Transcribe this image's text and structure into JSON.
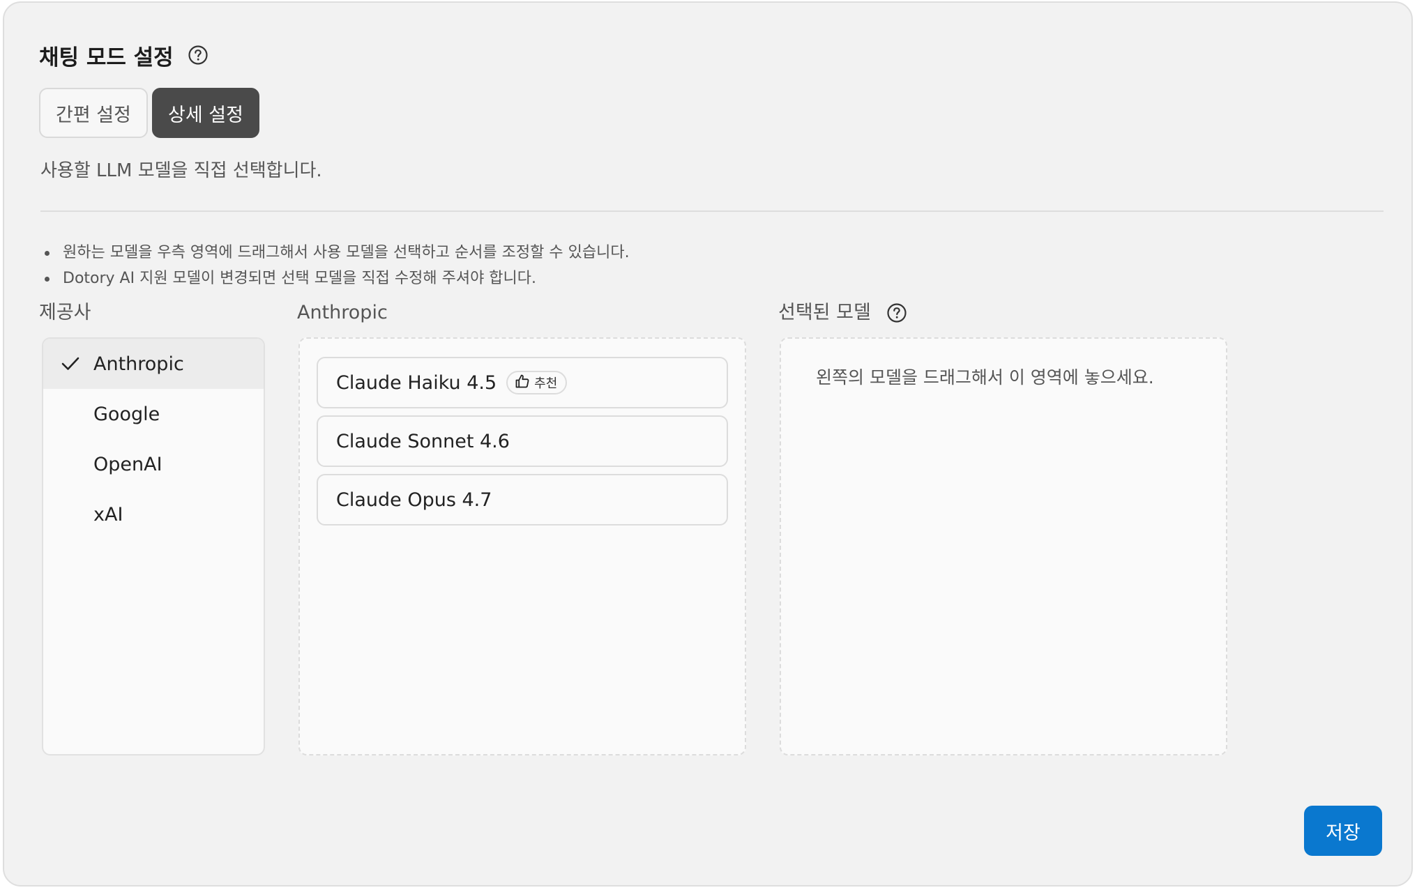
{
  "header": {
    "title": "채팅 모드 설정",
    "help_icon": "question-circle-icon"
  },
  "tabs": [
    {
      "label": "간편 설정",
      "active": false
    },
    {
      "label": "상세 설정",
      "active": true
    }
  ],
  "description": "사용할 LLM 모델을 직접 선택합니다.",
  "notes": [
    "원하는 모델을 우측 영역에 드래그해서 사용 모델을 선택하고 순서를 조정할 수 있습니다.",
    "Dotory AI 지원 모델이 변경되면 선택 모델을 직접 수정해 주셔야 합니다."
  ],
  "providers": {
    "label": "제공사",
    "items": [
      {
        "label": "Anthropic",
        "selected": true
      },
      {
        "label": "Google",
        "selected": false
      },
      {
        "label": "OpenAI",
        "selected": false
      },
      {
        "label": "xAI",
        "selected": false
      }
    ]
  },
  "models": {
    "label": "Anthropic",
    "items": [
      {
        "name": "Claude Haiku 4.5",
        "badge": "추천",
        "badge_icon": "thumbs-up-icon"
      },
      {
        "name": "Claude Sonnet 4.6"
      },
      {
        "name": "Claude Opus 4.7"
      }
    ]
  },
  "selected_models": {
    "label": "선택된 모델",
    "help_icon": "question-circle-icon",
    "placeholder": "왼쪽의 모델을 드래그해서 이 영역에 놓으세요."
  },
  "save_label": "저장",
  "colors": {
    "background": "#f2f2f2",
    "active_tab": "#4a4a4a",
    "primary": "#0a78cf",
    "selected_item": "#ececec"
  }
}
